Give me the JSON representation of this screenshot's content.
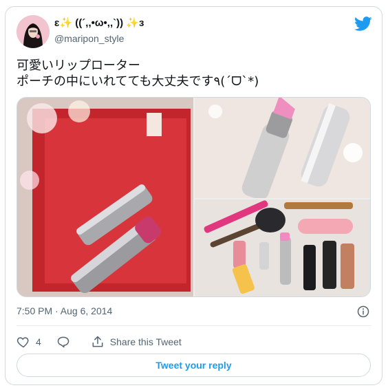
{
  "user": {
    "display_name": "ɛ✨ ((´,,•ω•,,`)) ✨ɜ",
    "handle": "@maripon_style"
  },
  "tweet": {
    "text": "可愛いリップローター\nポーチの中にいれてても大丈夫です٩(ˊᗜˋ*)",
    "timestamp": "7:50 PM · Aug 6, 2014"
  },
  "actions": {
    "like_count": "4",
    "share_label": "Share this Tweet"
  },
  "reply": {
    "label": "Tweet your reply"
  },
  "colors": {
    "accent": "#1d9bf0",
    "muted": "#536471",
    "border": "#cfd9de"
  },
  "icons": [
    "twitter-bird-icon",
    "info-icon",
    "heart-icon",
    "reply-bubble-icon",
    "share-icon"
  ]
}
